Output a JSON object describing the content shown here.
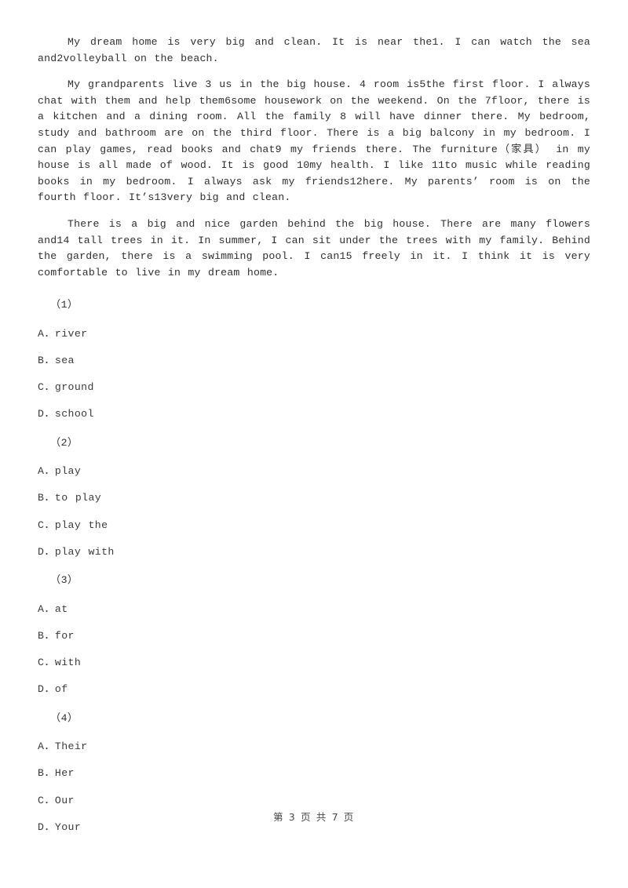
{
  "document": {
    "type": "cloze-test",
    "passage": [
      "My dream home is very big and clean. It is near the1. I can watch the sea and2volleyball on the beach.",
      "My grandparents live 3 us in the big house. 4 room is5the first floor. I always chat with them and help them6some housework on the weekend. On the 7floor, there is a kitchen and a dining room. All the family 8 will have dinner there. My bedroom, study and bathroom are on the third floor. There is a big balcony in my bedroom. I can play games, read books and chat9 my friends there. The furniture（家具） in my house is all made of wood. It is good 10my health. I like 11to music while reading books in my bedroom. I always ask my friends12here. My parents’ room is on the fourth floor. It’s13very big and clean.",
      "There is a big and nice garden behind the big house. There are many flowers and14 tall trees in it. In summer, I can sit under the trees with my family. Behind the garden, there is a swimming pool. I can15 freely in it. I think it is very comfortable to live in my dream home."
    ],
    "questions": [
      {
        "number": "（1）",
        "options": [
          "A．river",
          "B．sea",
          "C．ground",
          "D．school"
        ]
      },
      {
        "number": "（2）",
        "options": [
          "A．play",
          "B．to play",
          "C．play the",
          "D．play with"
        ]
      },
      {
        "number": "（3）",
        "options": [
          "A．at",
          "B．for",
          "C．with",
          "D．of"
        ]
      },
      {
        "number": "（4）",
        "options": [
          "A．Their",
          "B．Her",
          "C．Our",
          "D．Your"
        ]
      }
    ],
    "footer": "第 3 页 共 7 页"
  }
}
